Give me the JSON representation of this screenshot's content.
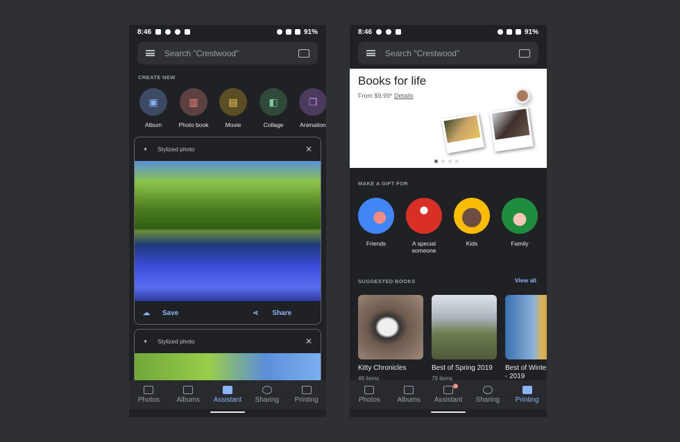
{
  "status": {
    "time": "8:46",
    "battery": "91%"
  },
  "search": {
    "placeholder": "Search \"Crestwood\""
  },
  "assistant_screen": {
    "create_new_label": "CREATE NEW",
    "create_items": [
      {
        "label": "Album",
        "color": "#3c4a63",
        "icon": "album-icon"
      },
      {
        "label": "Photo book",
        "color": "#5c4140",
        "icon": "photo-book-icon"
      },
      {
        "label": "Movie",
        "color": "#5b4d24",
        "icon": "movie-icon"
      },
      {
        "label": "Collage",
        "color": "#2f4a3a",
        "icon": "collage-icon"
      },
      {
        "label": "Animation",
        "color": "#4a3a5c",
        "icon": "animation-icon"
      }
    ],
    "cards": [
      {
        "title": "Stylized photo",
        "save": "Save",
        "share": "Share"
      },
      {
        "title": "Stylized photo"
      }
    ]
  },
  "printing_screen": {
    "banner": {
      "title": "Books for life",
      "price": "From $9.99*",
      "details": "Details",
      "pages": 4,
      "active_page": 1
    },
    "gift_label": "MAKE A GIFT FOR",
    "gifts": [
      {
        "label": "Friends",
        "color": "#4285f4"
      },
      {
        "label": "A special someone",
        "color": "#d93025"
      },
      {
        "label": "Kids",
        "color": "#fbbc04"
      },
      {
        "label": "Family",
        "color": "#1e8e3e"
      }
    ],
    "suggested_label": "SUGGESTED BOOKS",
    "view_all": "View all",
    "books": [
      {
        "title": "Kitty Chronicles",
        "count": "49 items"
      },
      {
        "title": "Best of Spring 2019",
        "count": "79 items"
      },
      {
        "title": "Best of Winte - 2019",
        "count": ""
      }
    ]
  },
  "nav": [
    {
      "label": "Photos",
      "icon": "photos-icon"
    },
    {
      "label": "Albums",
      "icon": "albums-icon"
    },
    {
      "label": "Assistant",
      "icon": "assistant-icon"
    },
    {
      "label": "Sharing",
      "icon": "sharing-icon"
    },
    {
      "label": "Printing",
      "icon": "printing-icon"
    }
  ],
  "colors": {
    "accent": "#8ab4f8",
    "background": "#202124"
  }
}
